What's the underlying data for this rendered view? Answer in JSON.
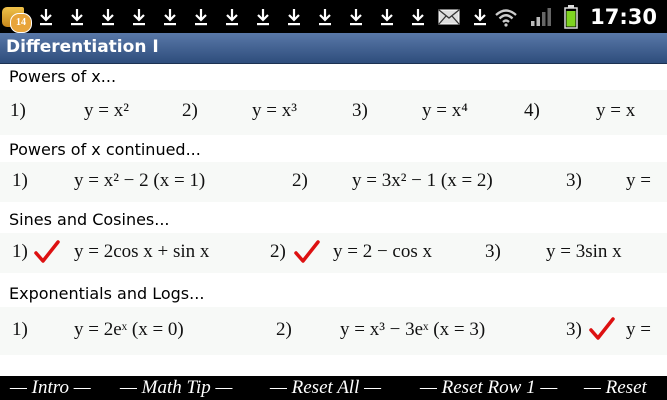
{
  "status": {
    "badge": "14",
    "time": "17:30",
    "icons": [
      "app-notification-icon",
      "download-icon",
      "download-icon",
      "download-icon",
      "download-icon",
      "download-icon",
      "download-icon",
      "download-icon",
      "download-icon",
      "download-icon",
      "download-icon",
      "download-icon",
      "download-icon",
      "download-icon",
      "mail-icon",
      "download-icon",
      "wifi-icon",
      "signal-icon",
      "battery-icon"
    ]
  },
  "title": "Differentiation I",
  "sections": [
    {
      "heading": "Powers of x...",
      "items": [
        {
          "num": "1)",
          "expr": "y = x²"
        },
        {
          "num": "2)",
          "expr": "y = x³"
        },
        {
          "num": "3)",
          "expr": "y = x⁴"
        },
        {
          "num": "4)",
          "expr": "y = x"
        }
      ]
    },
    {
      "heading": "Powers of x continued...",
      "items": [
        {
          "num": "1)",
          "expr": "y = x² − 2   (x = 1)"
        },
        {
          "num": "2)",
          "expr": "y = 3x² − 1   (x = 2)"
        },
        {
          "num": "3)",
          "expr": "y =",
          "checked": true
        }
      ]
    },
    {
      "heading": "Sines and Cosines...",
      "items": [
        {
          "num": "1)",
          "expr": "y = 2cos x + sin x",
          "checked": true
        },
        {
          "num": "2)",
          "expr": "y = 2 − cos x",
          "checked": true
        },
        {
          "num": "3)",
          "expr": "y = 3sin x"
        }
      ]
    },
    {
      "heading": "Exponentials and Logs...",
      "items": [
        {
          "num": "1)",
          "expr": "y = 2eˣ   (x = 0)"
        },
        {
          "num": "2)",
          "expr": "y = x³ − 3eˣ   (x = 3)"
        },
        {
          "num": "3)",
          "expr": "y =",
          "checked": true
        }
      ]
    }
  ],
  "bottom": {
    "intro": "— Intro —",
    "math_tip": "— Math Tip —",
    "reset_all": "— Reset All —",
    "reset_row": "— Reset Row 1 —",
    "reset": "— Reset"
  },
  "colors": {
    "check": "#dd1111",
    "title_bar": "#3f5f91",
    "status_bar": "#000000"
  }
}
